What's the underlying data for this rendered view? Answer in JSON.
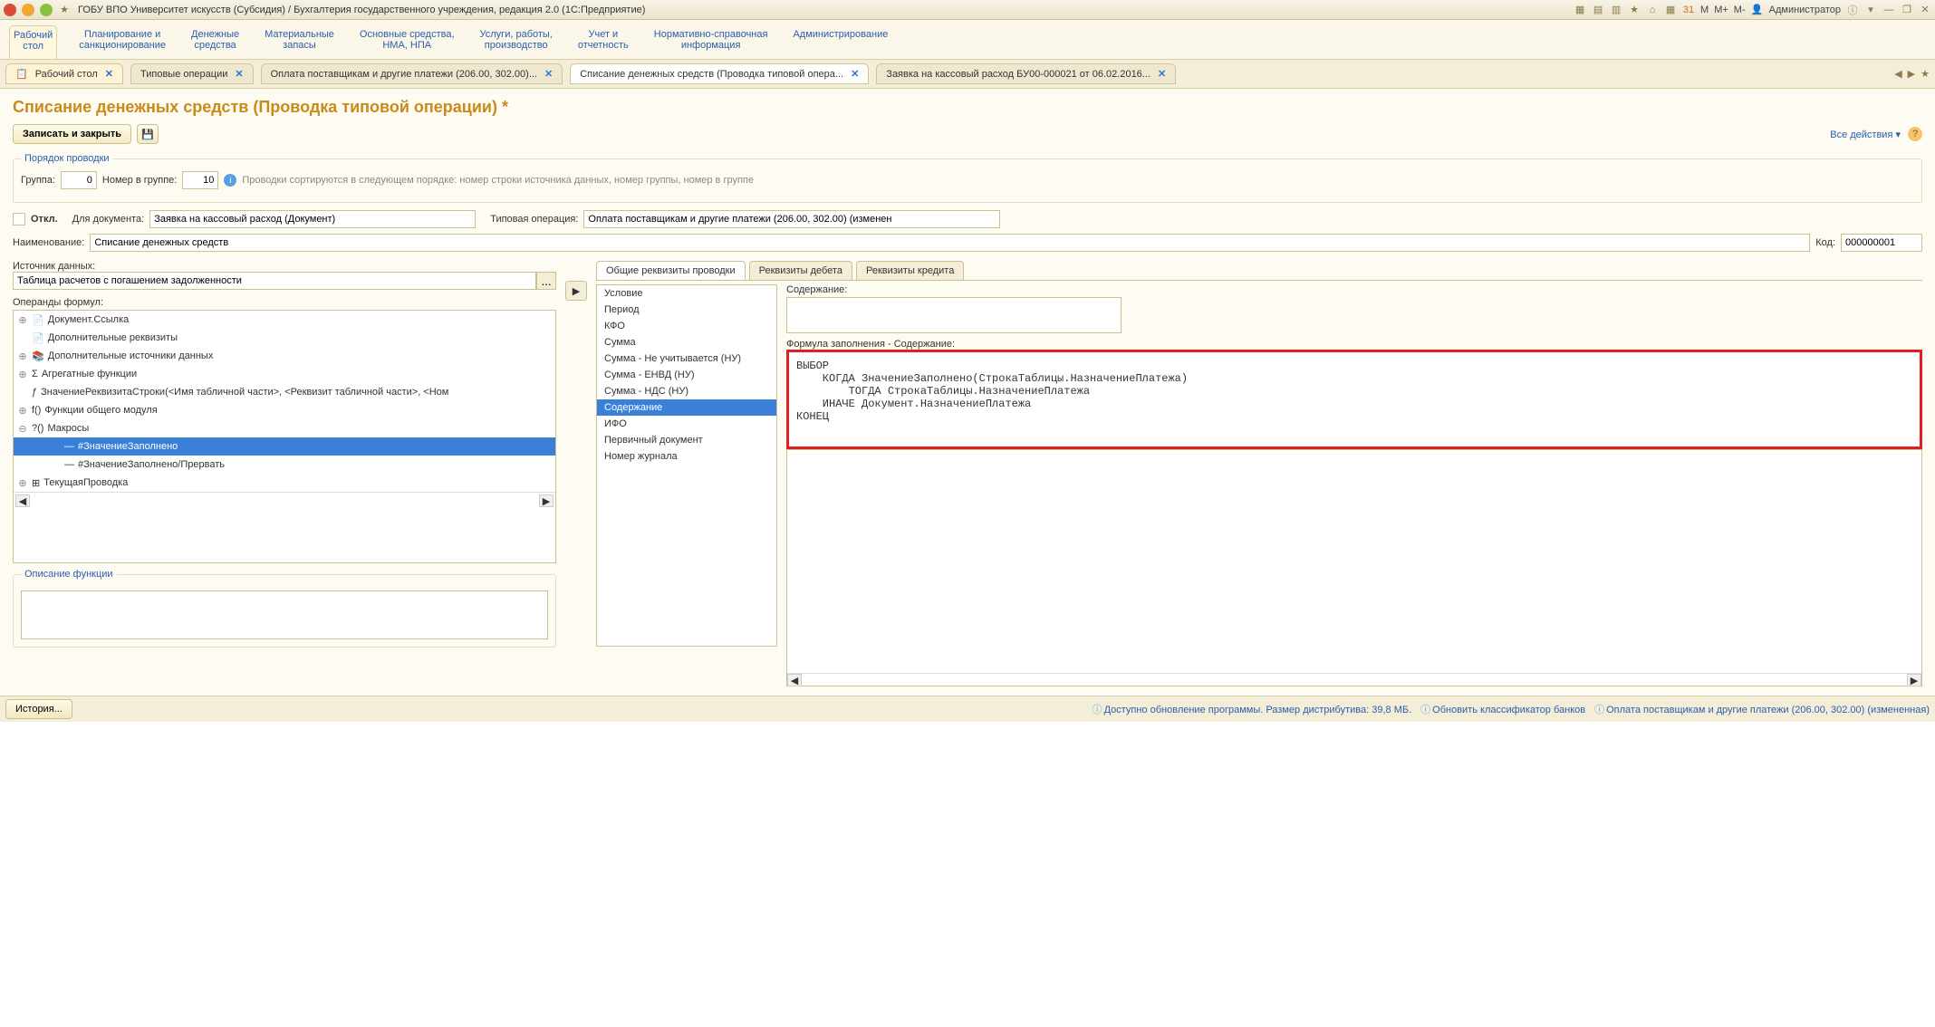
{
  "titlebar": {
    "title": "ГОБУ ВПО Университет искусств (Субсидия) / Бухгалтерия государственного учреждения, редакция 2.0  (1С:Предприятие)",
    "user_label": "Администратор",
    "buttons": {
      "m": "M",
      "mplus": "M+",
      "mminus": "M-"
    }
  },
  "sections": [
    "Рабочий\nстол",
    "Планирование и\nсанкционирование",
    "Денежные\nсредства",
    "Материальные\nзапасы",
    "Основные средства,\nНМА, НПА",
    "Услуги, работы,\nпроизводство",
    "Учет и\nотчетность",
    "Нормативно-справочная\nинформация",
    "Администрирование"
  ],
  "tabs": [
    {
      "label": "Рабочий стол",
      "desk": true
    },
    {
      "label": "Типовые операции"
    },
    {
      "label": "Оплата поставщикам и другие платежи (206.00, 302.00)..."
    },
    {
      "label": "Списание денежных средств (Проводка типовой опера...",
      "active": true
    },
    {
      "label": "Заявка на кассовый расход БУ00-000021 от 06.02.2016..."
    }
  ],
  "page": {
    "title": "Списание денежных средств (Проводка типовой операции) *",
    "save_close": "Записать и закрыть",
    "all_actions": "Все действия"
  },
  "order": {
    "legend": "Порядок проводки",
    "group_label": "Группа:",
    "group_value": "0",
    "num_label": "Номер в группе:",
    "num_value": "10",
    "hint": "Проводки сортируются в следующем порядке: номер строки источника данных, номер группы,  номер в группе"
  },
  "header": {
    "off_label": "Откл.",
    "doc_label": "Для документа:",
    "doc_value": "Заявка на кассовый расход (Документ)",
    "typ_label": "Типовая операция:",
    "typ_value": "Оплата поставщикам и другие платежи (206.00, 302.00) (изменен",
    "name_label": "Наименование:",
    "name_value": "Списание денежных средств",
    "code_label": "Код:",
    "code_value": "000000001"
  },
  "datasource": {
    "label": "Источник данных:",
    "value": "Таблица расчетов с погашением задолженности"
  },
  "operands": {
    "label": "Операнды формул:",
    "items": [
      {
        "exp": "⊕",
        "icon": "doc",
        "text": "Документ.Ссылка"
      },
      {
        "exp": "",
        "icon": "doc",
        "text": "Дополнительные реквизиты"
      },
      {
        "exp": "⊕",
        "icon": "data",
        "text": "Дополнительные источники данных"
      },
      {
        "exp": "⊕",
        "icon": "sigma",
        "text": "Агрегатные функции"
      },
      {
        "exp": "",
        "icon": "fx",
        "text": "ЗначениеРеквизитаСтроки(<Имя табличной части>, <Реквизит табличной части>, <Ном"
      },
      {
        "exp": "⊕",
        "icon": "fx2",
        "text": "Функции общего модуля"
      },
      {
        "exp": "⊖",
        "icon": "macro",
        "text": "Макросы"
      },
      {
        "exp": "",
        "icon": "leaf",
        "text": "#ЗначениеЗаполнено",
        "indent": 2,
        "selected": true
      },
      {
        "exp": "",
        "icon": "leaf",
        "text": "#ЗначениеЗаполнено/Прервать",
        "indent": 2
      },
      {
        "exp": "⊕",
        "icon": "table",
        "text": "ТекущаяПроводка"
      }
    ]
  },
  "funcdesc": {
    "legend": "Описание функции"
  },
  "subtabs": [
    {
      "label": "Общие реквизиты проводки",
      "active": true
    },
    {
      "label": "Реквизиты дебета"
    },
    {
      "label": "Реквизиты кредита"
    }
  ],
  "req_list": [
    "Условие",
    "Период",
    "КФО",
    "Сумма",
    "Сумма - Не учитывается (НУ)",
    "Сумма - ЕНВД (НУ)",
    "Сумма - НДС (НУ)",
    "Содержание",
    "ИФО",
    "Первичный документ",
    "Номер журнала"
  ],
  "req_selected": "Содержание",
  "content": {
    "label": "Содержание:",
    "formula_label": "Формула заполнения - Содержание:",
    "formula": "ВЫБОР\n    КОГДА ЗначениеЗаполнено(СтрокаТаблицы.НазначениеПлатежа)\n        ТОГДА СтрокаТаблицы.НазначениеПлатежа\n    ИНАЧЕ Документ.НазначениеПлатежа\nКОНЕЦ"
  },
  "footer": {
    "history": "История...",
    "s1": "Доступно обновление программы. Размер дистрибутива: 39,8 МБ.",
    "s2": "Обновить классификатор банков",
    "s3": "Оплата поставщикам и другие платежи (206.00, 302.00) (измененная)"
  }
}
